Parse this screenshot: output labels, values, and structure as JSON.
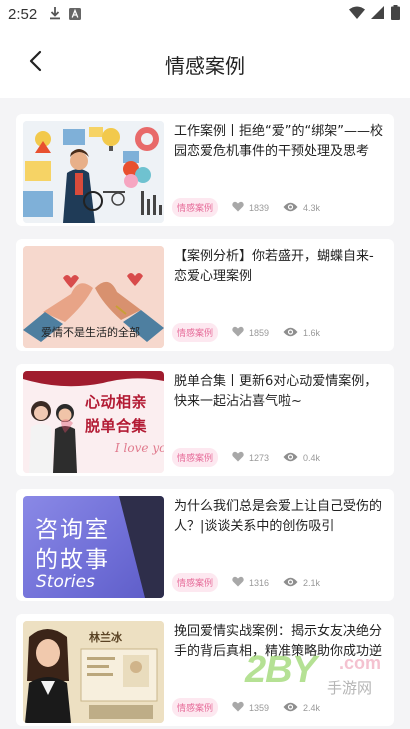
{
  "status_bar": {
    "time": "2:52",
    "left_icons": [
      "download-icon",
      "font-a-icon"
    ],
    "right_icons": [
      "wifi-icon",
      "signal-icon",
      "battery-icon"
    ]
  },
  "header": {
    "title": "情感案例",
    "back_icon": "chevron-left-icon"
  },
  "articles": [
    {
      "title": "工作案例丨拒绝“爱”的“绑架”——校园恋爱危机事件的干预处理及思考",
      "tag": "情感案例",
      "likes": "1839",
      "views": "4.3k",
      "thumb_text": []
    },
    {
      "title": "【案例分析】你若盛开，蝴蝶自来-恋爱心理案例",
      "tag": "情感案例",
      "likes": "1859",
      "views": "1.6k",
      "thumb_text": [
        "爱情不是生活的全部"
      ]
    },
    {
      "title": "脱单合集丨更新6对心动爱情案例，快来一起沾沾喜气啦~",
      "tag": "情感案例",
      "likes": "1273",
      "views": "0.4k",
      "thumb_text": [
        "心动相亲",
        "脱单合集",
        "I love you"
      ]
    },
    {
      "title": "为什么我们总是会爱上让自己受伤的人？|谈谈关系中的创伤吸引",
      "tag": "情感案例",
      "likes": "1316",
      "views": "2.1k",
      "thumb_text": [
        "咨询室",
        "的故事",
        "Stories"
      ]
    },
    {
      "title": "挽回爱情实战案例：揭示女友决绝分手的背后真相，精准策略助你成功逆袭",
      "tag": "情感案例",
      "likes": "1359",
      "views": "2.4k",
      "thumb_text": [
        "林兰冰"
      ]
    }
  ],
  "watermark": {
    "text": "2BY",
    "sub": "手游网",
    "domain": ".com"
  },
  "colors": {
    "tag_bg": "#fde8f0",
    "tag_text": "#e66b99",
    "meta_text": "#999999",
    "page_bg": "#f4f4f6",
    "card_bg": "#ffffff"
  }
}
